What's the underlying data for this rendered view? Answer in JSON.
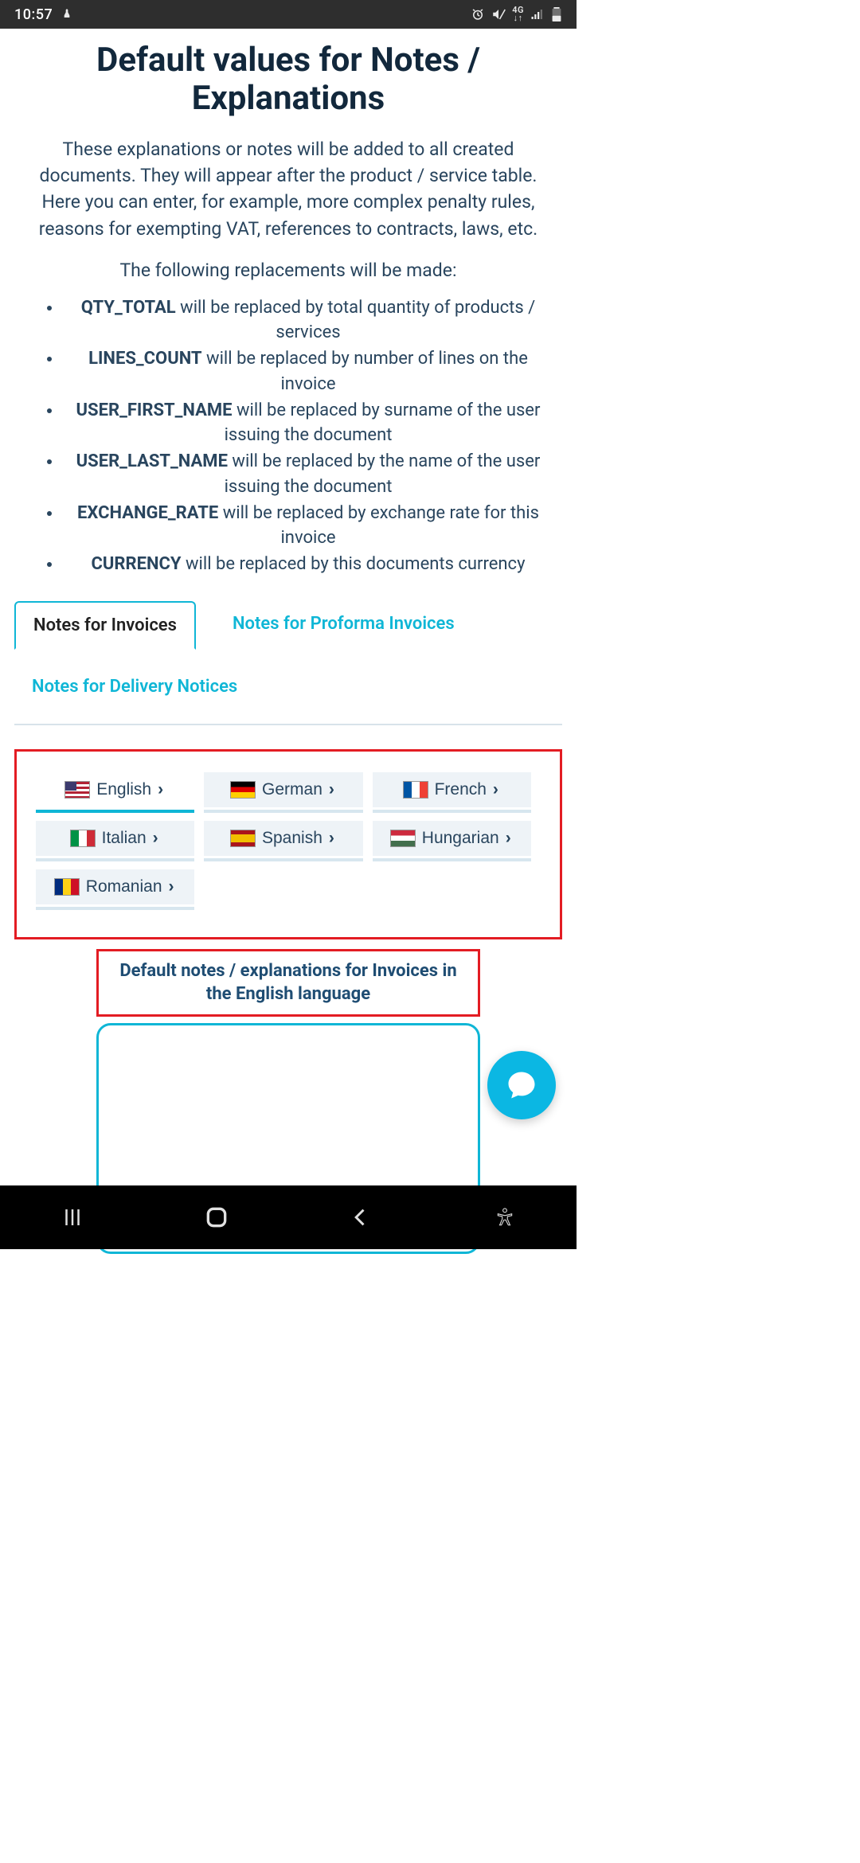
{
  "status": {
    "time": "10:57",
    "network_label": "4G"
  },
  "title": "Default values for Notes / Explanations",
  "intro": "These explanations or notes will be added to all created documents. They will appear after the product / service table.\nHere you can enter, for example, more complex penalty rules, reasons for exempting VAT, references to contracts, laws, etc.",
  "replacements_intro": "The following replacements will be made:",
  "replacements": [
    {
      "key": "QTY_TOTAL",
      "desc": " will be replaced by total quantity of products / services"
    },
    {
      "key": "LINES_COUNT",
      "desc": " will be replaced by number of lines on the invoice"
    },
    {
      "key": "USER_FIRST_NAME",
      "desc": " will be replaced by surname of the user issuing the document"
    },
    {
      "key": "USER_LAST_NAME",
      "desc": " will be replaced by the name of the user issuing the document"
    },
    {
      "key": "EXCHANGE_RATE",
      "desc": " will be replaced by exchange rate for this invoice"
    },
    {
      "key": "CURRENCY",
      "desc": " will be replaced by this documents currency"
    }
  ],
  "tabs": [
    {
      "label": "Notes for Invoices",
      "active": true
    },
    {
      "label": "Notes for Proforma Invoices",
      "active": false
    },
    {
      "label": "Notes for Delivery Notices",
      "active": false
    }
  ],
  "languages": [
    {
      "label": "English",
      "flag": "us",
      "active": true
    },
    {
      "label": "German",
      "flag": "de",
      "active": false
    },
    {
      "label": "French",
      "flag": "fr",
      "active": false
    },
    {
      "label": "Italian",
      "flag": "it",
      "active": false
    },
    {
      "label": "Spanish",
      "flag": "es",
      "active": false
    },
    {
      "label": "Hungarian",
      "flag": "hu",
      "active": false
    },
    {
      "label": "Romanian",
      "flag": "ro",
      "active": false
    }
  ],
  "section_heading": "Default notes / explanations for Invoices in the English language",
  "notes_value": ""
}
